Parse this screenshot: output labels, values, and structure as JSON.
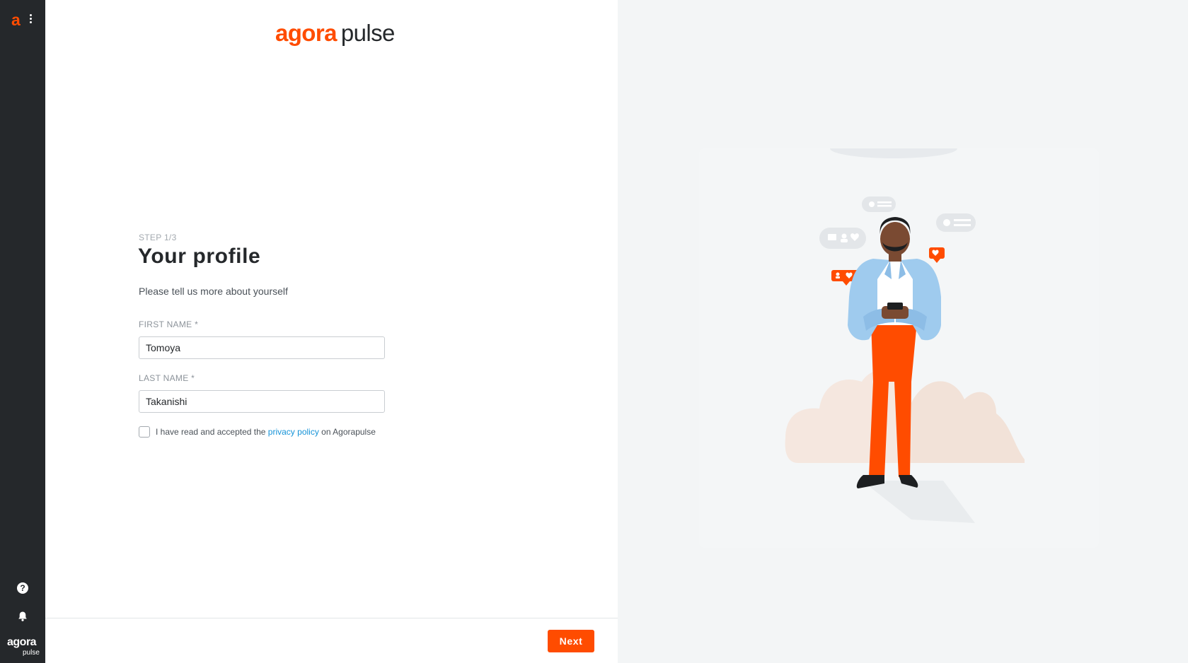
{
  "sidebar": {
    "logo_mark": "a",
    "brand_word1": "agora",
    "brand_word2": "pulse"
  },
  "header": {
    "logo_agora": "agora",
    "logo_pulse": "pulse"
  },
  "form": {
    "step": "STEP 1/3",
    "title": "Your profile",
    "subtitle": "Please tell us more about yourself",
    "first_name": {
      "label": "FIRST NAME *",
      "value": "Tomoya"
    },
    "last_name": {
      "label": "LAST NAME *",
      "value": "Takanishi"
    },
    "consent": {
      "before": "I have read and accepted the ",
      "link": "privacy policy",
      "after": " on Agorapulse",
      "checked": false
    }
  },
  "footer": {
    "next_label": "Next"
  },
  "colors": {
    "brand_orange": "#ff4c00",
    "sidebar_dark": "#25282b",
    "link_blue": "#1593d8",
    "jacket_blue": "#9fcbee"
  },
  "icons": [
    "agorapulse-logo-icon",
    "kebab-menu-icon",
    "help-icon",
    "bell-icon",
    "checkbox-icon"
  ]
}
